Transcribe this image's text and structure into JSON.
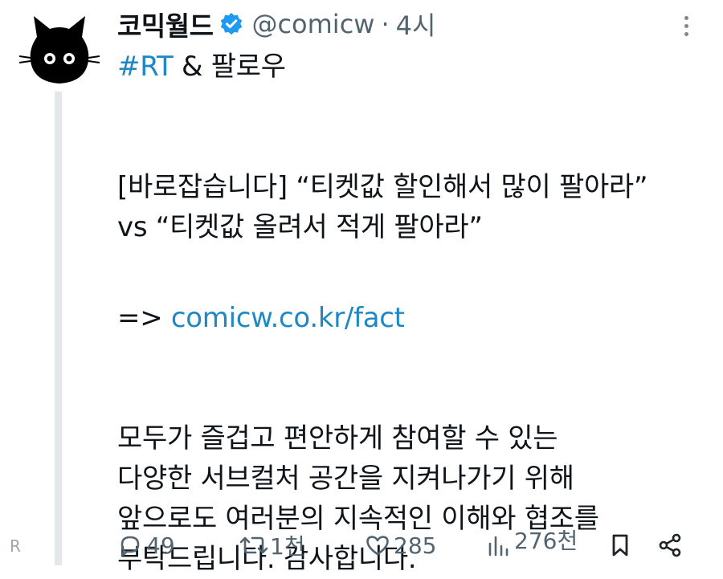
{
  "tweet": {
    "display_name": "코믹월드",
    "handle": "@comicw",
    "separator": "·",
    "time": "4시",
    "hashtag": "#RT",
    "title_rest": " & 팔로우",
    "line1": "[바로잡습니다] “티켓값 할인해서 많이 팔아라”",
    "line2": "vs “티켓값 올려서 적게 팔아라”",
    "arrow": "=> ",
    "link": "comicw.co.kr/fact",
    "body_lines": [
      "모두가 즐겁고 편안하게 참여할 수 있는",
      "다양한 서브컬처 공간을 지켜나가기 위해",
      "앞으로도 여러분의 지속적인 이해와 협조를",
      "부탁드립니다. 감사합니다."
    ]
  },
  "actions": {
    "replies": "49",
    "reposts": "1천",
    "likes": "285",
    "views": "276천"
  },
  "side_marker": "R",
  "icons": {
    "avatar": "black-cat-avatar",
    "verified": "verified-badge-icon",
    "more": "more-vertical-icon",
    "reply": "reply-icon",
    "repost": "repost-icon",
    "like": "heart-icon",
    "views": "views-chart-icon",
    "bookmark": "bookmark-icon",
    "share": "share-icon"
  },
  "colors": {
    "link": "#1e88c4",
    "verified": "#1d9bf0",
    "muted": "#536471",
    "thread_line": "#e4e8ec"
  }
}
